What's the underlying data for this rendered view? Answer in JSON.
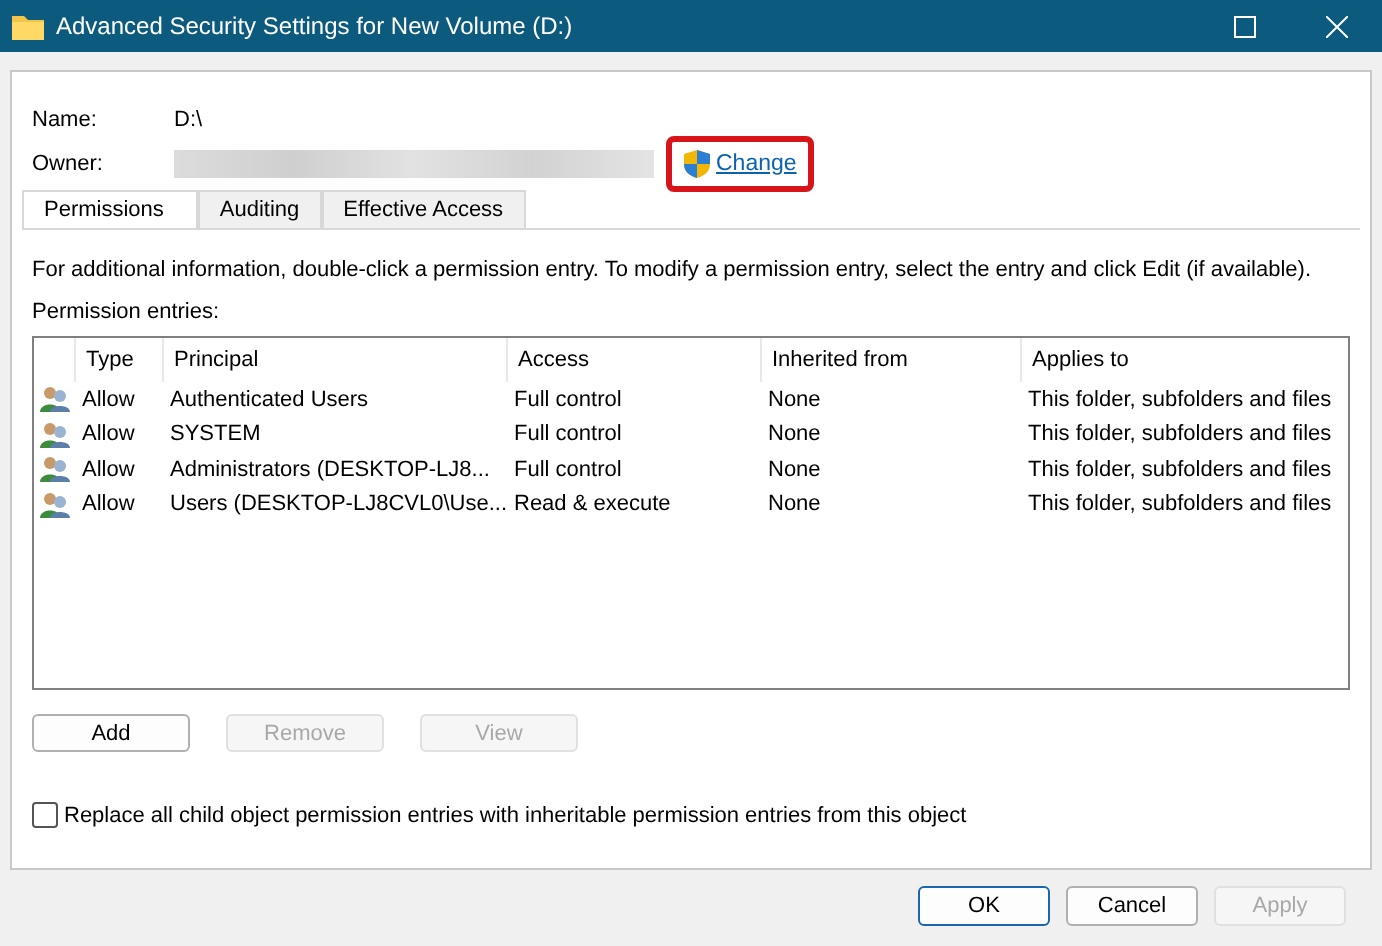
{
  "window": {
    "title": "Advanced Security Settings for New Volume (D:)"
  },
  "name": {
    "label": "Name:",
    "value": "D:\\"
  },
  "owner": {
    "label": "Owner:",
    "change_link": {
      "label": "Change",
      "highlighted": true
    }
  },
  "tabs": [
    {
      "label": "Permissions",
      "selected": true
    },
    {
      "label": "Auditing",
      "selected": false
    },
    {
      "label": "Effective Access",
      "selected": false
    }
  ],
  "info_text": "For additional information, double-click a permission entry. To modify a permission entry, select the entry and click Edit (if available).",
  "entries_label": "Permission entries:",
  "table": {
    "columns": [
      "Type",
      "Principal",
      "Access",
      "Inherited from",
      "Applies to"
    ],
    "rows": [
      {
        "type": "Allow",
        "principal": "Authenticated Users",
        "access": "Full control",
        "inherited_from": "None",
        "applies_to": "This folder, subfolders and files"
      },
      {
        "type": "Allow",
        "principal": "SYSTEM",
        "access": "Full control",
        "inherited_from": "None",
        "applies_to": "This folder, subfolders and files"
      },
      {
        "type": "Allow",
        "principal": "Administrators (DESKTOP-LJ8...",
        "access": "Full control",
        "inherited_from": "None",
        "applies_to": "This folder, subfolders and files"
      },
      {
        "type": "Allow",
        "principal": "Users (DESKTOP-LJ8CVL0\\Use...",
        "access": "Read & execute",
        "inherited_from": "None",
        "applies_to": "This folder, subfolders and files"
      }
    ]
  },
  "entry_buttons": [
    {
      "label": "Add",
      "disabled": false
    },
    {
      "label": "Remove",
      "disabled": true
    },
    {
      "label": "View",
      "disabled": true
    }
  ],
  "replace_checkbox": {
    "label": "Replace all child object permission entries with inheritable permission entries from this object",
    "checked": false
  },
  "dialog_buttons": [
    {
      "label": "OK",
      "disabled": false,
      "default": true
    },
    {
      "label": "Cancel",
      "disabled": false,
      "default": false
    },
    {
      "label": "Apply",
      "disabled": true,
      "default": false
    }
  ]
}
